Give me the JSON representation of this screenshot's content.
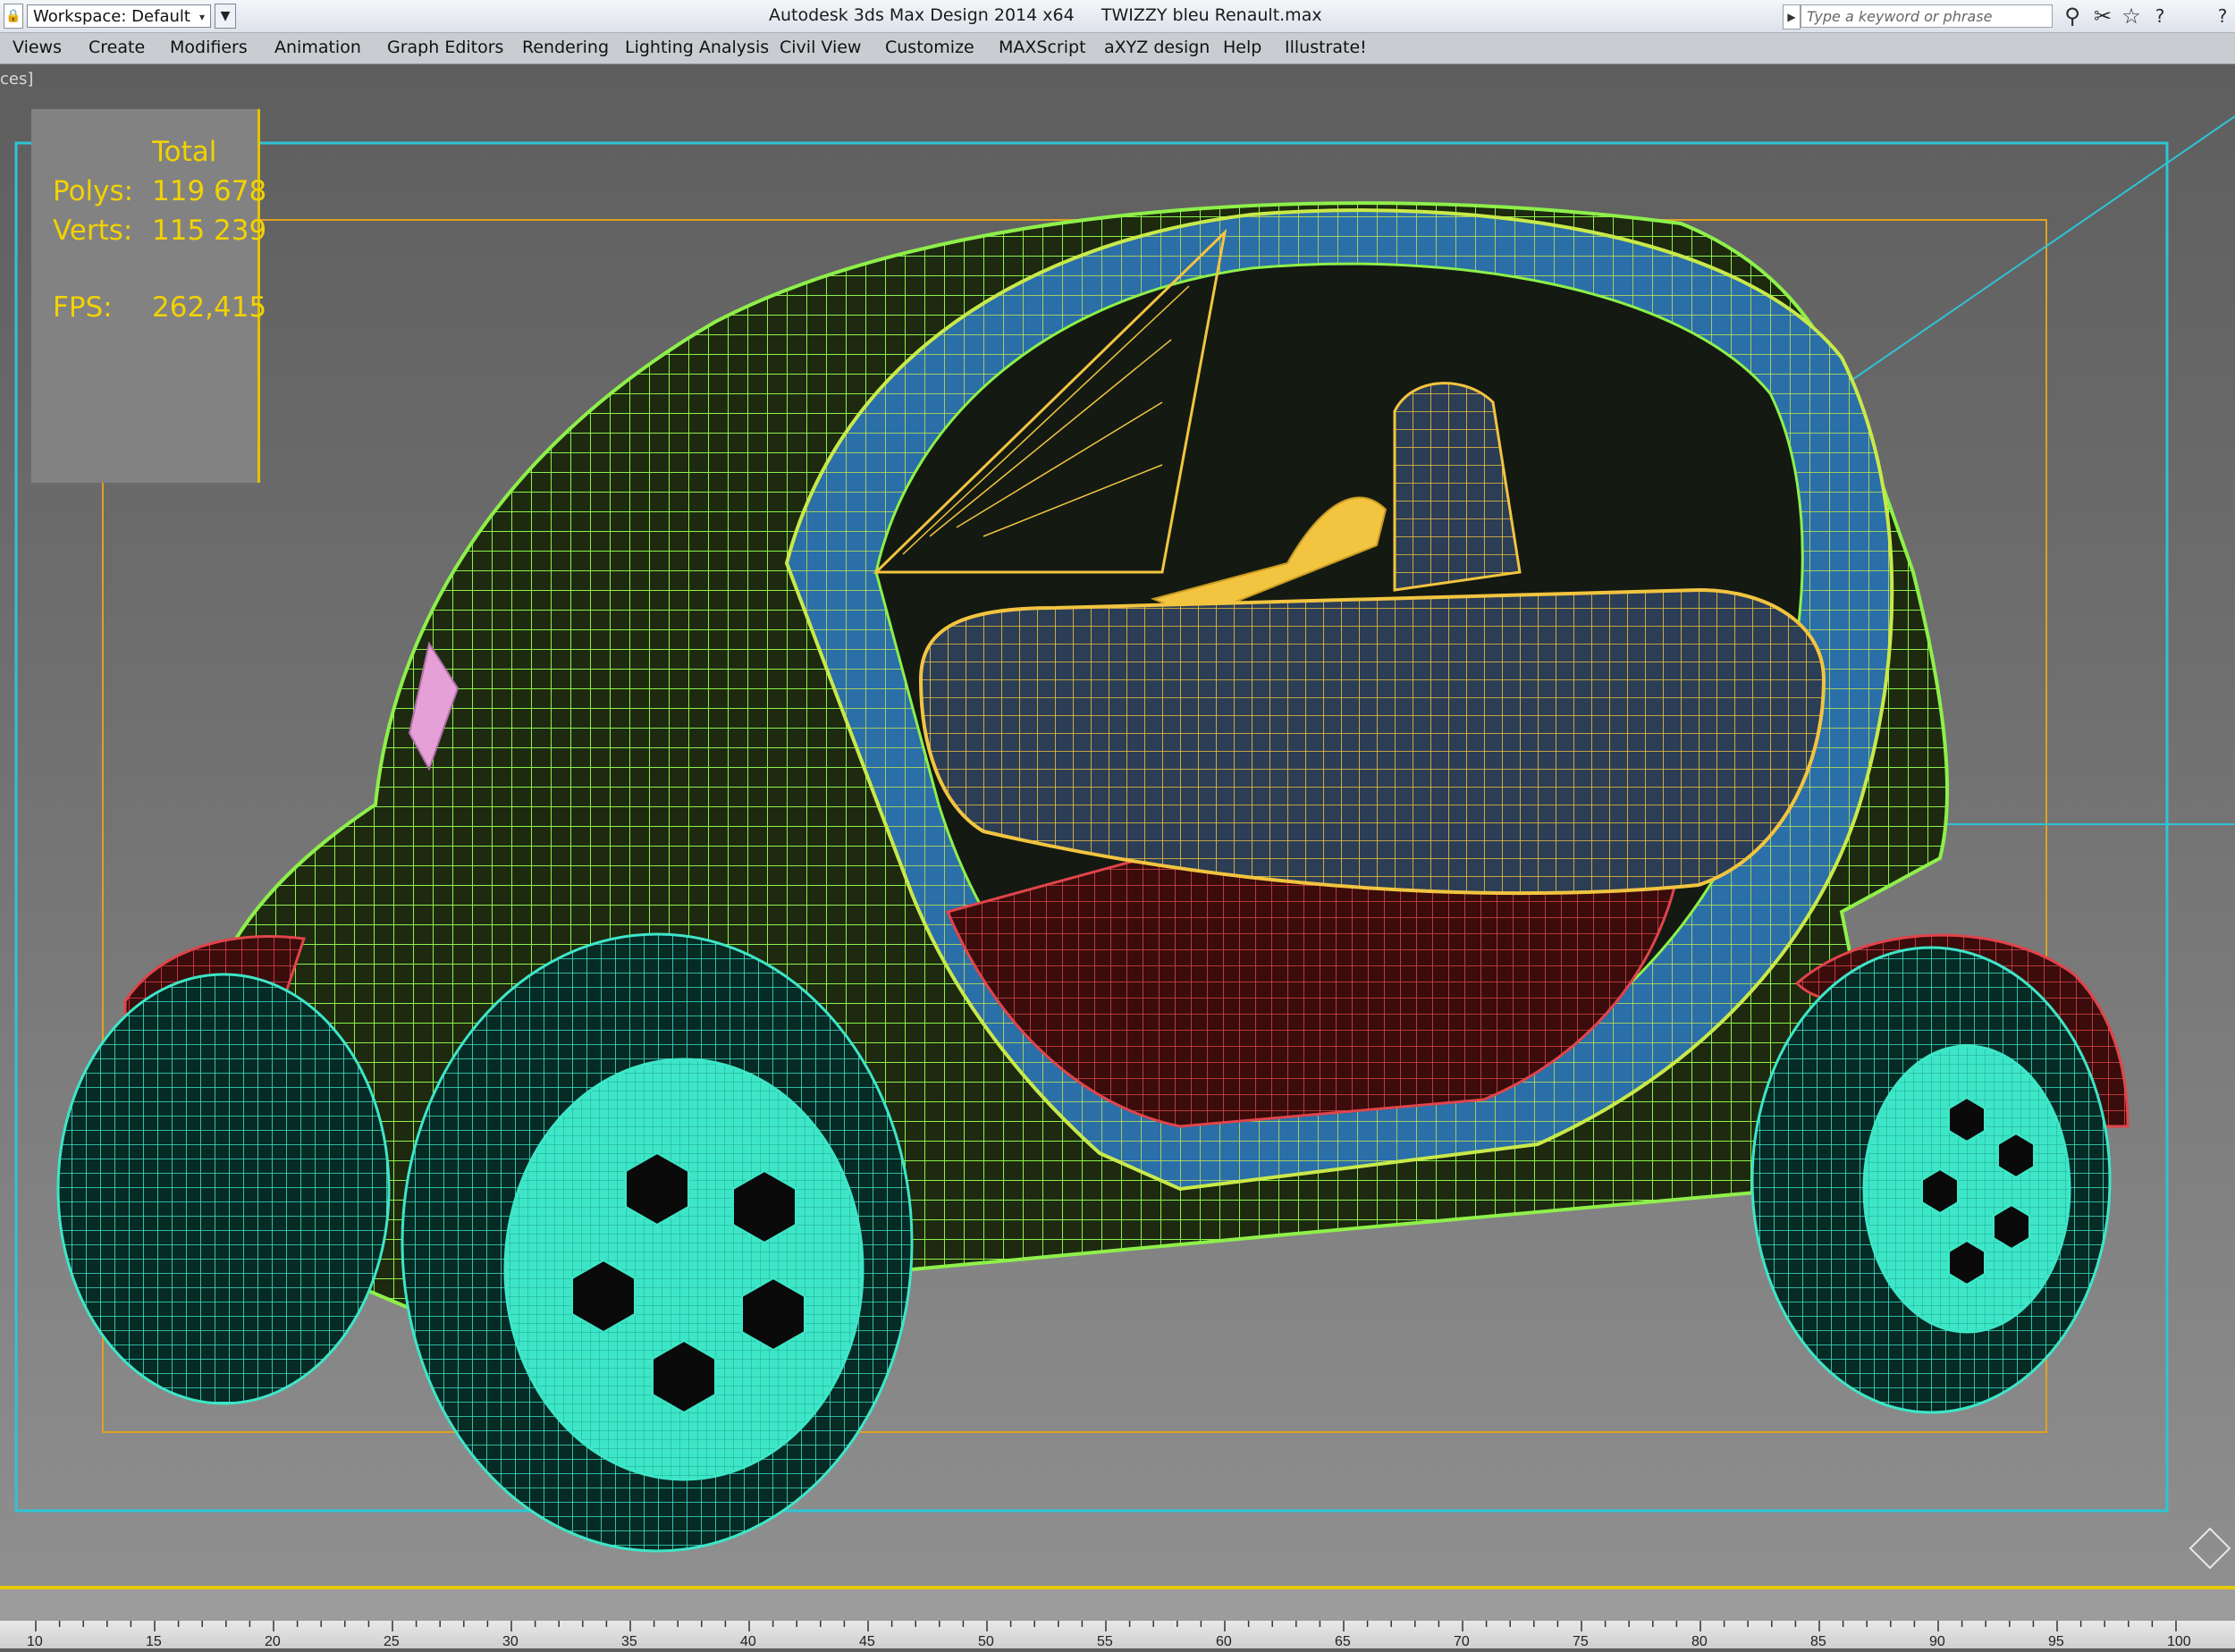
{
  "titlebar": {
    "workspace_icon": "lock-icon",
    "workspace_label": "Workspace: Default",
    "app_title": "Autodesk 3ds Max Design 2014 x64     TWIZZY bleu Renault.max",
    "search_placeholder": "Type a keyword or phrase",
    "icons": [
      "binoculars-icon",
      "tools-icon",
      "star-icon",
      "help-icon"
    ]
  },
  "menu": [
    "Views",
    "Create",
    "Modifiers",
    "Animation",
    "Graph Editors",
    "Rendering",
    "Lighting Analysis",
    "Civil View",
    "Customize",
    "MAXScript",
    "aXYZ design",
    "Help",
    "Illustrate!"
  ],
  "viewport": {
    "label": "ces]",
    "stats": {
      "header": "Total",
      "polys_label": "Polys:",
      "polys_value": "119 678",
      "verts_label": "Verts:",
      "verts_value": "115 239",
      "fps_label": "FPS:",
      "fps_value": "262,415"
    }
  },
  "timeline": {
    "ticks": [
      "10",
      "15",
      "20",
      "25",
      "30",
      "35",
      "40",
      "45",
      "50",
      "55",
      "60",
      "65",
      "70",
      "75",
      "80",
      "85",
      "90",
      "95",
      "100"
    ]
  },
  "colors": {
    "body_wire": "#8ef04a",
    "frame_wire": "#2f9ad8",
    "seat_wire": "#f2c440",
    "fender_wire": "#e0444a",
    "wheel_wire": "#3ee6c8",
    "stats_text": "#f2d200",
    "safe_frame": "#e0a020",
    "render_frame": "#2ec4d6"
  }
}
